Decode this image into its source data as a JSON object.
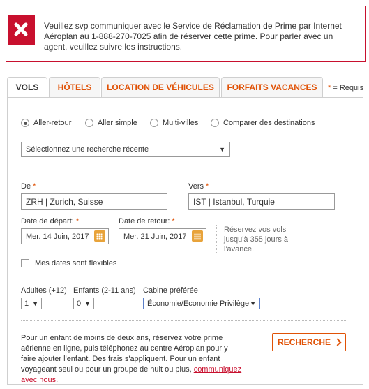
{
  "alert": {
    "message": "Veuillez svp communiquer avec le Service de Réclamation de Prime par Internet Aéroplan au 1-888-270-7025 afin de réserver cette prime. Pour parler avec un agent, veuillez suivre les instructions."
  },
  "tabs": [
    {
      "label": "VOLS"
    },
    {
      "label": "HÔTELS"
    },
    {
      "label": "LOCATION DE VÉHICULES"
    },
    {
      "label": "FORFAITS VACANCES"
    }
  ],
  "required_note": {
    "star": "*",
    "text": "= Requis"
  },
  "trip_types": [
    {
      "label": "Aller-retour",
      "checked": true
    },
    {
      "label": "Aller simple",
      "checked": false
    },
    {
      "label": "Multi-villes",
      "checked": false
    },
    {
      "label": "Comparer des destinations",
      "checked": false
    }
  ],
  "recent_search": {
    "value": "Sélectionnez une recherche récente"
  },
  "from": {
    "label": "De",
    "value": "ZRH | Zurich, Suisse"
  },
  "to": {
    "label": "Vers",
    "value": "IST | Istanbul, Turquie"
  },
  "depart": {
    "label": "Date de départ:",
    "value": "Mer. 14 Juin, 2017"
  },
  "return": {
    "label": "Date de retour:",
    "value": "Mer. 21 Juin, 2017"
  },
  "hint": "Réservez vos vols jusqu'à 355 jours à l'avance.",
  "flexible": {
    "label": "Mes dates sont flexibles",
    "checked": false
  },
  "adults": {
    "label": "Adultes (+12)",
    "value": "1"
  },
  "children": {
    "label": "Enfants (2-11 ans)",
    "value": "0"
  },
  "cabin": {
    "label": "Cabine préférée",
    "value": "Économie/Economie Privilège"
  },
  "infant_note": {
    "text": "Pour un enfant de moins de deux ans, réservez votre prime aérienne en ligne, puis téléphonez au centre Aéroplan pour y faire ajouter l'enfant. Des frais s'appliquent. Pour un enfant voyageant seul ou pour un groupe de huit ou plus, ",
    "link": "communiquez avec nous",
    "end": "."
  },
  "search_button": {
    "label": "RECHERCHE"
  },
  "colors": {
    "accent": "#e05206",
    "error": "#c8102e"
  }
}
